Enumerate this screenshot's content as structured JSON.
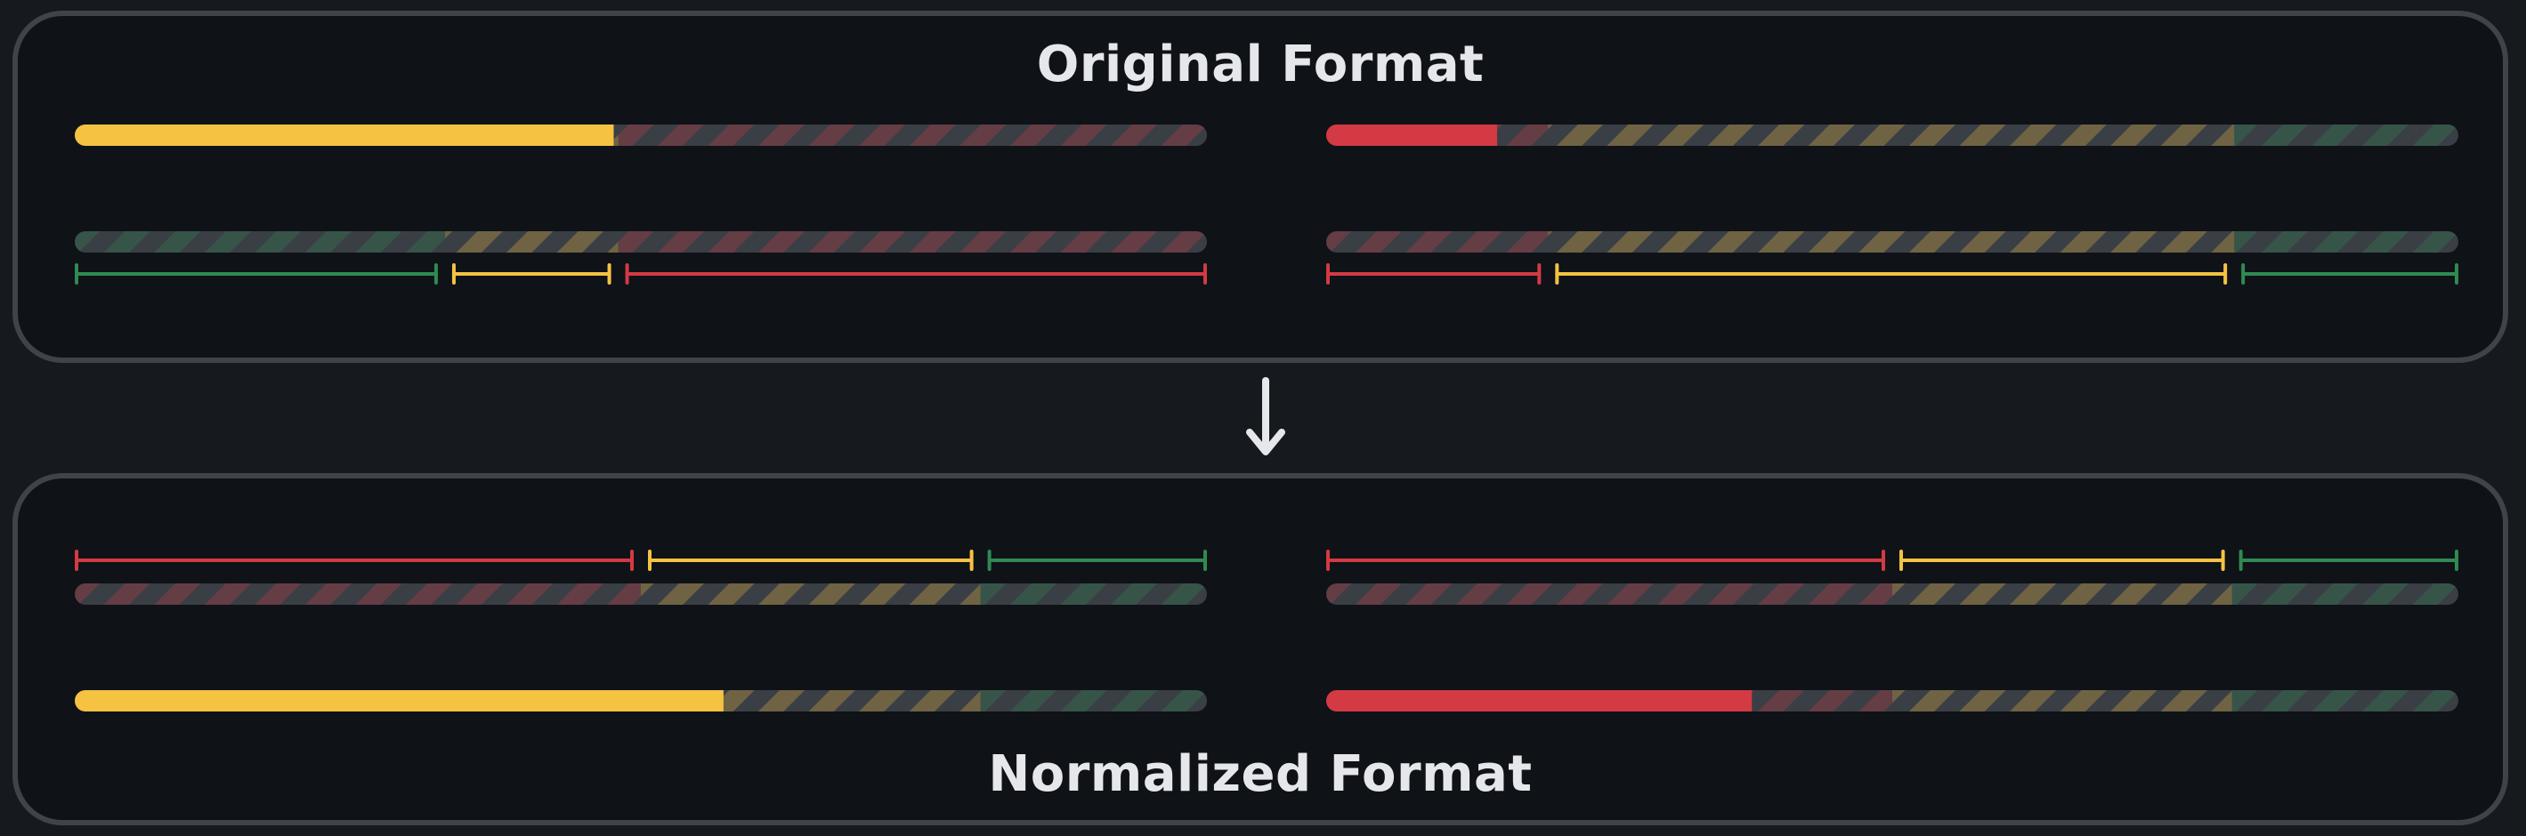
{
  "colors": {
    "red": "#d33a43",
    "yellow": "#f5c242",
    "green": "#2f8a52",
    "panel_border": "#3f434a",
    "panel_bg": "#0f1217",
    "page_bg": "#16191e",
    "title_text": "#e6e7ea"
  },
  "top_panel": {
    "title": "Original Format"
  },
  "bottom_panel": {
    "title": "Normalized Format"
  },
  "arrow": {
    "icon": "down-arrow-icon"
  },
  "diagram": {
    "original": [
      {
        "id": "original-left",
        "zones": [
          {
            "color": "green",
            "fraction": 0.327
          },
          {
            "color": "yellow",
            "fraction": 0.153
          },
          {
            "color": "red",
            "fraction": 0.52
          }
        ],
        "zone_order_on_track": [
          "green",
          "yellow",
          "red"
        ],
        "progress": {
          "color": "yellow",
          "fraction": 0.476
        }
      },
      {
        "id": "original-right",
        "zones": [
          {
            "color": "red",
            "fraction": 0.196
          },
          {
            "color": "yellow",
            "fraction": 0.606
          },
          {
            "color": "green",
            "fraction": 0.198
          }
        ],
        "zone_order_on_track": [
          "red",
          "yellow",
          "green"
        ],
        "progress": {
          "color": "red",
          "fraction": 0.151
        }
      }
    ],
    "normalized": [
      {
        "id": "normalized-left",
        "zones": [
          {
            "color": "red",
            "fraction": 0.5
          },
          {
            "color": "yellow",
            "fraction": 0.3
          },
          {
            "color": "green",
            "fraction": 0.2
          }
        ],
        "progress": {
          "color": "yellow",
          "fraction": 0.573
        }
      },
      {
        "id": "normalized-right",
        "zones": [
          {
            "color": "red",
            "fraction": 0.5
          },
          {
            "color": "yellow",
            "fraction": 0.3
          },
          {
            "color": "green",
            "fraction": 0.2
          }
        ],
        "progress": {
          "color": "red",
          "fraction": 0.376
        }
      }
    ]
  }
}
